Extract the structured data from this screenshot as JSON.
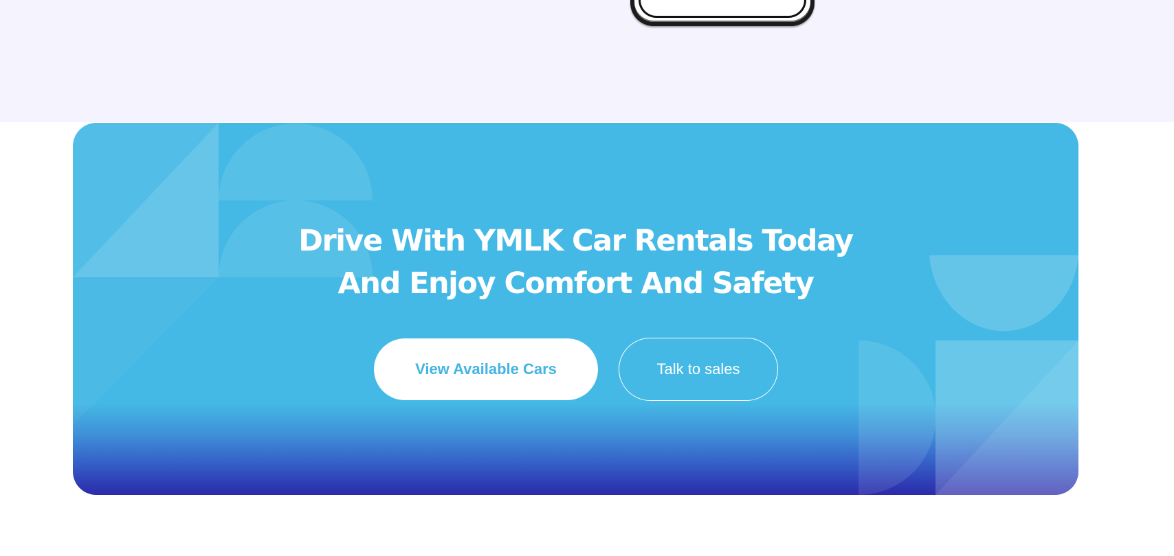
{
  "cta": {
    "title_line1": "Drive With YMLK Car Rentals Today",
    "title_line2": "And Enjoy Comfort And Safety",
    "primary_button_label": "View Available Cars",
    "secondary_button_label": "Talk to sales"
  },
  "colors": {
    "page_top_background": "#f5f4fe",
    "card_blue": "#44b9e5",
    "card_bottom_indigo": "#2b2aaa",
    "primary_button_text": "#44b4e2",
    "white": "#ffffff"
  },
  "icons": [
    "phone-mockup-edge",
    "decorative-geometric-shapes"
  ]
}
